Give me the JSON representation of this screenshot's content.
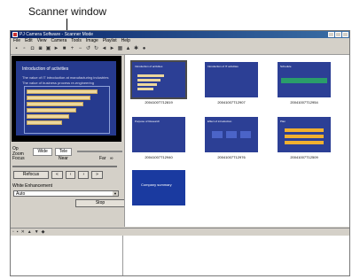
{
  "caption": "Scanner window",
  "window": {
    "title": "PJ Camera Software - Scanner Mode",
    "menu": [
      "File",
      "Edit",
      "View",
      "Camera",
      "Tools",
      "Image",
      "Playlist",
      "Help"
    ]
  },
  "preview": {
    "slide_title": "Introduction of activities",
    "slide_lines": [
      "The value of IT introduction at manufacturing industries",
      "The value of business process re-engineering"
    ]
  },
  "controls": {
    "op_zoom_label": "Op Zoom",
    "wide_label": "Wide",
    "tele_label": "Tele",
    "focus_label": "Focus",
    "focus_near": "Near",
    "focus_far": "Far",
    "focus_inf": "∞",
    "refocus_label": "Refocus",
    "wb_label": "White Enhancement",
    "wb_value": "Auto",
    "stop_label": "Stop"
  },
  "thumbnails": [
    {
      "label": "2004100T712819",
      "title": "Introduction of activities"
    },
    {
      "label": "20041007T12907",
      "title": "Introduction of IT activities"
    },
    {
      "label": "20041007T12954",
      "title": "Schedule"
    },
    {
      "label": "20041007T12940",
      "title": "Purpose of Research"
    },
    {
      "label": "20041007T12976",
      "title": "Effect of introduction"
    },
    {
      "label": "20041007T12509",
      "title": "Plan"
    },
    {
      "label": "",
      "title": "Company summary"
    }
  ],
  "colors": {
    "slide_bg": "#263a8e",
    "bar": "#ecd79c"
  }
}
